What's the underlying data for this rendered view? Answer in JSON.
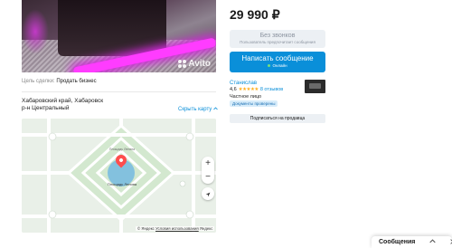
{
  "listing": {
    "watermark": "Avito",
    "goal_label": "Цель сделки:",
    "goal_value": "Продать бизнес",
    "address_line1": "Хабаровский край, Хабаровск",
    "address_line2": "р-н Центральный",
    "hide_map": "Скрыть карту"
  },
  "map": {
    "place_label_top": "Площадь Ленина",
    "place_label": "Площадь Ленина",
    "zoom_in": "+",
    "zoom_out": "−",
    "footer_yandex": "© Яндекс",
    "footer_terms": "Условия использования",
    "footer_provider": "Яндекс"
  },
  "sidebar": {
    "price": "29 990 ₽",
    "no_calls_title": "Без звонков",
    "no_calls_sub": "Пользователь предпочитает сообщения",
    "write_message": "Написать сообщение",
    "online": "Онлайн",
    "seller_name": "Станислав",
    "rating": "4,6",
    "stars": "★★★★★",
    "reviews": "8 отзывов",
    "seller_type": "Частное лицо",
    "verified_badge": "Документы проверены",
    "subscribe": "Подписаться на продавца"
  },
  "messages_tab": {
    "label": "Сообщения",
    "expand_icon": "chevron-up-icon",
    "close_icon": "close-icon"
  },
  "colors": {
    "accent": "#0a8fd9",
    "pin": "#ff4d4d",
    "star": "#ffb021"
  }
}
